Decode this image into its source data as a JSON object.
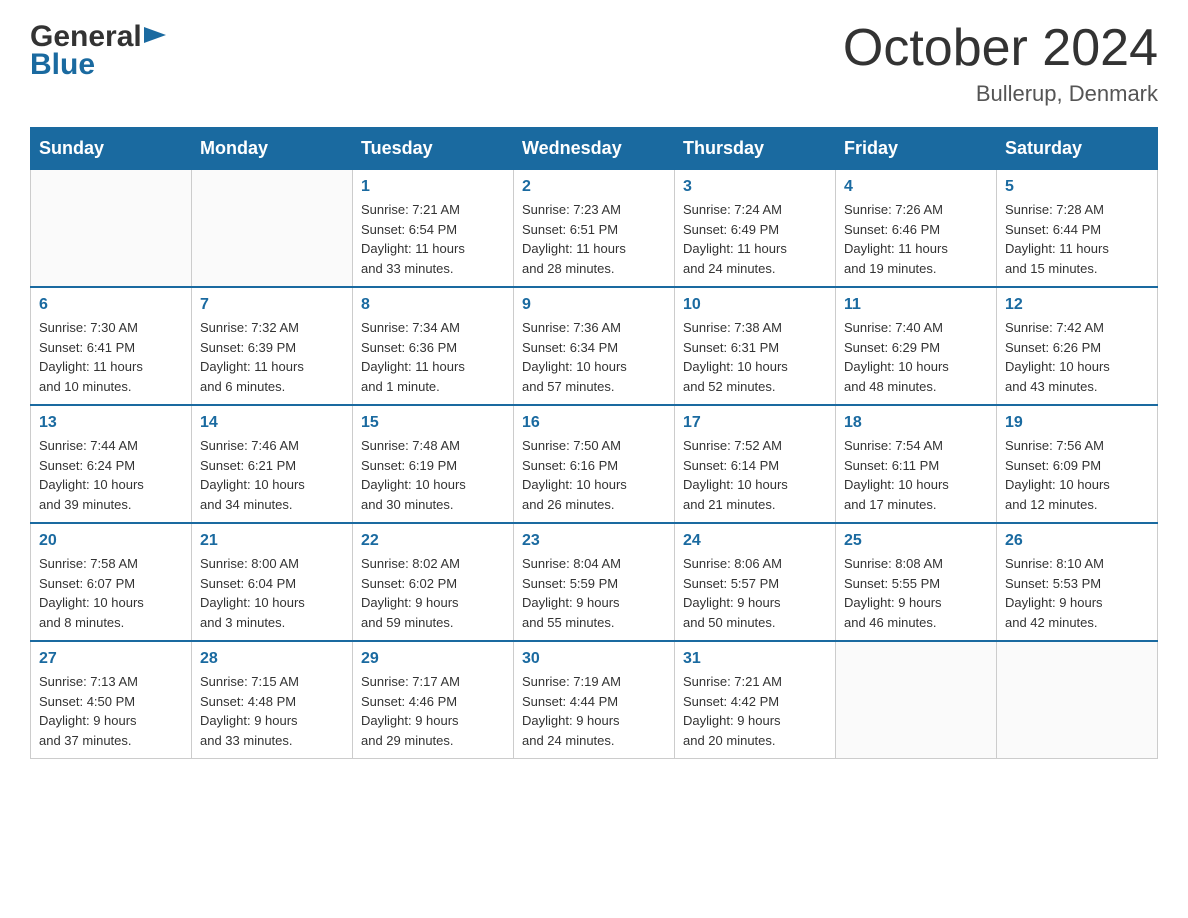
{
  "header": {
    "logo_general": "General",
    "logo_blue": "Blue",
    "month": "October 2024",
    "location": "Bullerup, Denmark"
  },
  "days_of_week": [
    "Sunday",
    "Monday",
    "Tuesday",
    "Wednesday",
    "Thursday",
    "Friday",
    "Saturday"
  ],
  "weeks": [
    [
      {
        "day": "",
        "info": ""
      },
      {
        "day": "",
        "info": ""
      },
      {
        "day": "1",
        "info": "Sunrise: 7:21 AM\nSunset: 6:54 PM\nDaylight: 11 hours\nand 33 minutes."
      },
      {
        "day": "2",
        "info": "Sunrise: 7:23 AM\nSunset: 6:51 PM\nDaylight: 11 hours\nand 28 minutes."
      },
      {
        "day": "3",
        "info": "Sunrise: 7:24 AM\nSunset: 6:49 PM\nDaylight: 11 hours\nand 24 minutes."
      },
      {
        "day": "4",
        "info": "Sunrise: 7:26 AM\nSunset: 6:46 PM\nDaylight: 11 hours\nand 19 minutes."
      },
      {
        "day": "5",
        "info": "Sunrise: 7:28 AM\nSunset: 6:44 PM\nDaylight: 11 hours\nand 15 minutes."
      }
    ],
    [
      {
        "day": "6",
        "info": "Sunrise: 7:30 AM\nSunset: 6:41 PM\nDaylight: 11 hours\nand 10 minutes."
      },
      {
        "day": "7",
        "info": "Sunrise: 7:32 AM\nSunset: 6:39 PM\nDaylight: 11 hours\nand 6 minutes."
      },
      {
        "day": "8",
        "info": "Sunrise: 7:34 AM\nSunset: 6:36 PM\nDaylight: 11 hours\nand 1 minute."
      },
      {
        "day": "9",
        "info": "Sunrise: 7:36 AM\nSunset: 6:34 PM\nDaylight: 10 hours\nand 57 minutes."
      },
      {
        "day": "10",
        "info": "Sunrise: 7:38 AM\nSunset: 6:31 PM\nDaylight: 10 hours\nand 52 minutes."
      },
      {
        "day": "11",
        "info": "Sunrise: 7:40 AM\nSunset: 6:29 PM\nDaylight: 10 hours\nand 48 minutes."
      },
      {
        "day": "12",
        "info": "Sunrise: 7:42 AM\nSunset: 6:26 PM\nDaylight: 10 hours\nand 43 minutes."
      }
    ],
    [
      {
        "day": "13",
        "info": "Sunrise: 7:44 AM\nSunset: 6:24 PM\nDaylight: 10 hours\nand 39 minutes."
      },
      {
        "day": "14",
        "info": "Sunrise: 7:46 AM\nSunset: 6:21 PM\nDaylight: 10 hours\nand 34 minutes."
      },
      {
        "day": "15",
        "info": "Sunrise: 7:48 AM\nSunset: 6:19 PM\nDaylight: 10 hours\nand 30 minutes."
      },
      {
        "day": "16",
        "info": "Sunrise: 7:50 AM\nSunset: 6:16 PM\nDaylight: 10 hours\nand 26 minutes."
      },
      {
        "day": "17",
        "info": "Sunrise: 7:52 AM\nSunset: 6:14 PM\nDaylight: 10 hours\nand 21 minutes."
      },
      {
        "day": "18",
        "info": "Sunrise: 7:54 AM\nSunset: 6:11 PM\nDaylight: 10 hours\nand 17 minutes."
      },
      {
        "day": "19",
        "info": "Sunrise: 7:56 AM\nSunset: 6:09 PM\nDaylight: 10 hours\nand 12 minutes."
      }
    ],
    [
      {
        "day": "20",
        "info": "Sunrise: 7:58 AM\nSunset: 6:07 PM\nDaylight: 10 hours\nand 8 minutes."
      },
      {
        "day": "21",
        "info": "Sunrise: 8:00 AM\nSunset: 6:04 PM\nDaylight: 10 hours\nand 3 minutes."
      },
      {
        "day": "22",
        "info": "Sunrise: 8:02 AM\nSunset: 6:02 PM\nDaylight: 9 hours\nand 59 minutes."
      },
      {
        "day": "23",
        "info": "Sunrise: 8:04 AM\nSunset: 5:59 PM\nDaylight: 9 hours\nand 55 minutes."
      },
      {
        "day": "24",
        "info": "Sunrise: 8:06 AM\nSunset: 5:57 PM\nDaylight: 9 hours\nand 50 minutes."
      },
      {
        "day": "25",
        "info": "Sunrise: 8:08 AM\nSunset: 5:55 PM\nDaylight: 9 hours\nand 46 minutes."
      },
      {
        "day": "26",
        "info": "Sunrise: 8:10 AM\nSunset: 5:53 PM\nDaylight: 9 hours\nand 42 minutes."
      }
    ],
    [
      {
        "day": "27",
        "info": "Sunrise: 7:13 AM\nSunset: 4:50 PM\nDaylight: 9 hours\nand 37 minutes."
      },
      {
        "day": "28",
        "info": "Sunrise: 7:15 AM\nSunset: 4:48 PM\nDaylight: 9 hours\nand 33 minutes."
      },
      {
        "day": "29",
        "info": "Sunrise: 7:17 AM\nSunset: 4:46 PM\nDaylight: 9 hours\nand 29 minutes."
      },
      {
        "day": "30",
        "info": "Sunrise: 7:19 AM\nSunset: 4:44 PM\nDaylight: 9 hours\nand 24 minutes."
      },
      {
        "day": "31",
        "info": "Sunrise: 7:21 AM\nSunset: 4:42 PM\nDaylight: 9 hours\nand 20 minutes."
      },
      {
        "day": "",
        "info": ""
      },
      {
        "day": "",
        "info": ""
      }
    ]
  ]
}
